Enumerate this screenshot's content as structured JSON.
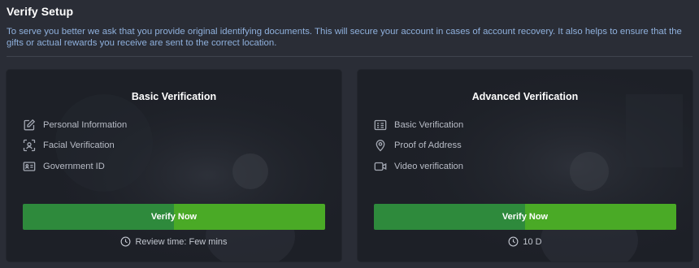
{
  "page": {
    "title": "Verify Setup",
    "description": "To serve you better we ask that you provide original identifying documents. This will secure your account in cases of account recovery. It also helps to ensure that the gifts or actual rewards you receive are sent to the correct location."
  },
  "basic": {
    "title": "Basic Verification",
    "features": [
      {
        "label": "Personal Information",
        "icon": "edit-icon"
      },
      {
        "label": "Facial Verification",
        "icon": "face-scan-icon"
      },
      {
        "label": "Government ID",
        "icon": "id-card-icon"
      }
    ],
    "button_label": "Verify Now",
    "footer": "Review time: Few mins",
    "footer_icon": "clock-icon"
  },
  "advanced": {
    "title": "Advanced Verification",
    "features": [
      {
        "label": "Basic Verification",
        "icon": "id-card-icon"
      },
      {
        "label": "Proof of Address",
        "icon": "location-pin-icon"
      },
      {
        "label": "Video verification",
        "icon": "video-icon"
      }
    ],
    "button_label": "Verify Now",
    "footer": "10 D",
    "footer_icon": "clock-icon"
  },
  "colors": {
    "background": "#2a2d36",
    "card": "#1d2027",
    "button_dark": "#2e8a3c",
    "button_light": "#4aaa26",
    "description_text": "#8fb0dc"
  }
}
